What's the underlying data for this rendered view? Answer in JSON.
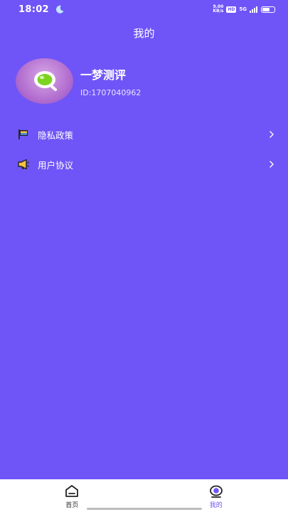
{
  "status_bar": {
    "time": "18:02",
    "net_speed_value": "9.00",
    "net_speed_unit": "KB/s",
    "hd_badge": "HD",
    "signal_label": "5G",
    "battery_level": 0.65
  },
  "header": {
    "title": "我的"
  },
  "profile": {
    "app_name": "一梦测评",
    "user_id": "ID:1707040962"
  },
  "menu": {
    "items": [
      {
        "label": "隐私政策",
        "icon": "flag-icon"
      },
      {
        "label": "用户协议",
        "icon": "megaphone-icon"
      }
    ]
  },
  "tab_bar": {
    "tabs": [
      {
        "label": "首页",
        "icon": "home-icon",
        "active": false
      },
      {
        "label": "我的",
        "icon": "profile-icon",
        "active": true
      }
    ]
  },
  "colors": {
    "background": "#6F55F8",
    "accent": "#6F55F8",
    "tab_bar": "#FFFFFF"
  }
}
